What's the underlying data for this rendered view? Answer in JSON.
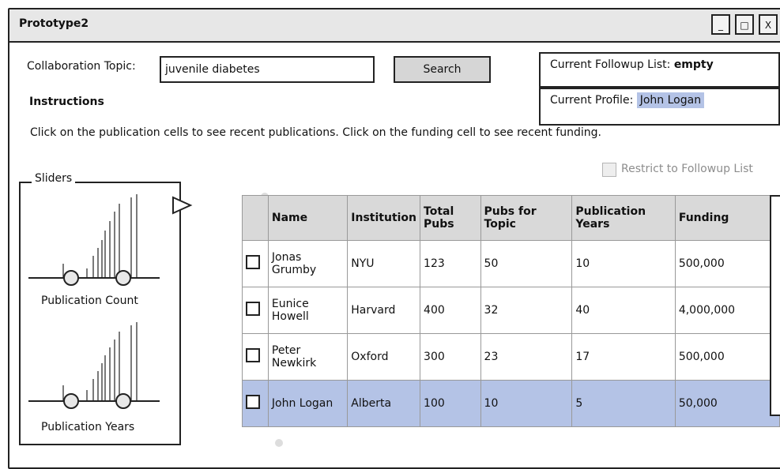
{
  "window": {
    "title": "Prototype2",
    "buttons": [
      "_",
      "□",
      "X"
    ]
  },
  "search": {
    "label": "Collaboration Topic:",
    "value": "juvenile diabetes",
    "button": "Search"
  },
  "followup": {
    "label": "Current Followup List:",
    "value": "empty"
  },
  "profile": {
    "label": "Current Profile:",
    "value": "John Logan"
  },
  "instructions": {
    "heading": "Instructions",
    "text": "Click on the publication cells to see recent publications.  Click on the funding cell to see recent funding."
  },
  "restrict": {
    "label": "Restrict to Followup List",
    "checked": false
  },
  "sliders": {
    "legend": "Sliders",
    "items": [
      {
        "label": "Publication Count"
      },
      {
        "label": "Publication Years"
      }
    ]
  },
  "table": {
    "columns": [
      "Name",
      "Institution",
      "Total\nPubs",
      "Pubs for\nTopic",
      "Publication\nYears",
      "Funding"
    ],
    "rows": [
      [
        "Jonas\nGrumby",
        "NYU",
        "123",
        "50",
        "10",
        "500,000"
      ],
      [
        "Eunice\nHowell",
        "Harvard",
        "400",
        "32",
        "40",
        "4,000,000"
      ],
      [
        "Peter\nNewkirk",
        "Oxford",
        "300",
        "23",
        "17",
        "500,000"
      ],
      [
        "John Logan",
        "Alberta",
        "100",
        "10",
        "5",
        "50,000"
      ]
    ],
    "selected_row": 3
  },
  "colors": {
    "highlight": "#b4c3e6",
    "header_bg": "#d9d9d9",
    "titlebar_bg": "#e7e7e7"
  }
}
